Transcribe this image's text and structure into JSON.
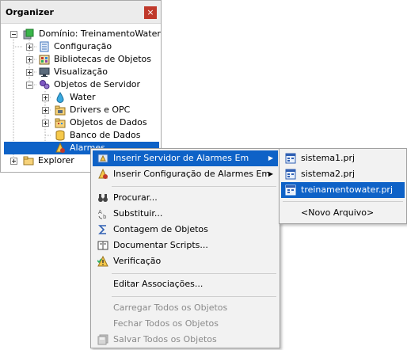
{
  "organizer": {
    "title": "Organizer",
    "close_glyph": "×",
    "tree": [
      {
        "label": "Domínio: TreinamentoWater",
        "icon": "domain-icon",
        "expander": "minus"
      },
      {
        "label": "Configuração",
        "icon": "config-icon",
        "expander": "plus"
      },
      {
        "label": "Bibliotecas de Objetos",
        "icon": "library-icon",
        "expander": "plus"
      },
      {
        "label": "Visualização",
        "icon": "monitor-icon",
        "expander": "plus"
      },
      {
        "label": "Objetos de Servidor",
        "icon": "server-objects-icon",
        "expander": "minus"
      },
      {
        "label": "Water",
        "icon": "water-drop-icon",
        "expander": "plus"
      },
      {
        "label": "Drivers e OPC",
        "icon": "drivers-icon",
        "expander": "plus"
      },
      {
        "label": "Objetos de Dados",
        "icon": "data-objects-icon",
        "expander": "plus"
      },
      {
        "label": "Banco de Dados",
        "icon": "database-icon",
        "expander": "none"
      },
      {
        "label": "Alarmes",
        "icon": "alarm-icon",
        "expander": "none",
        "selected": true
      },
      {
        "label": "Explorer",
        "icon": "folder-icon",
        "expander": "plus"
      }
    ]
  },
  "context_menu": {
    "items": [
      {
        "label": "Inserir Servidor de Alarmes Em",
        "icon": "alarm-server-icon",
        "submenu": true,
        "highlighted": true
      },
      {
        "label": "Inserir Configuração de Alarmes Em",
        "icon": "alarm-config-icon",
        "submenu": true
      },
      {
        "label": "Procurar...",
        "icon": "binoculars-icon"
      },
      {
        "label": "Substituir...",
        "icon": "replace-icon"
      },
      {
        "label": "Contagem de Objetos",
        "icon": "sigma-icon"
      },
      {
        "label": "Documentar Scripts...",
        "icon": "book-icon"
      },
      {
        "label": "Verificação",
        "icon": "warning-check-icon"
      },
      {
        "label": "Editar Associações..."
      },
      {
        "label": "Carregar Todos os Objetos",
        "disabled": true
      },
      {
        "label": "Fechar Todos os Objetos",
        "disabled": true
      },
      {
        "label": "Salvar Todos os Objetos",
        "icon": "save-all-icon",
        "disabled": true
      }
    ],
    "submenu_arrow": "▶"
  },
  "submenu": {
    "items": [
      {
        "label": "sistema1.prj",
        "icon": "project-file-icon"
      },
      {
        "label": "sistema2.prj",
        "icon": "project-file-icon"
      },
      {
        "label": "treinamentowater.prj",
        "icon": "project-file-icon",
        "highlighted": true
      },
      {
        "label": "<Novo Arquivo>"
      }
    ]
  },
  "colors": {
    "selection": "#0e62c7",
    "close_button": "#c0392b",
    "menu_background": "#f2f2f2",
    "disabled_text": "#8a8a8a"
  }
}
